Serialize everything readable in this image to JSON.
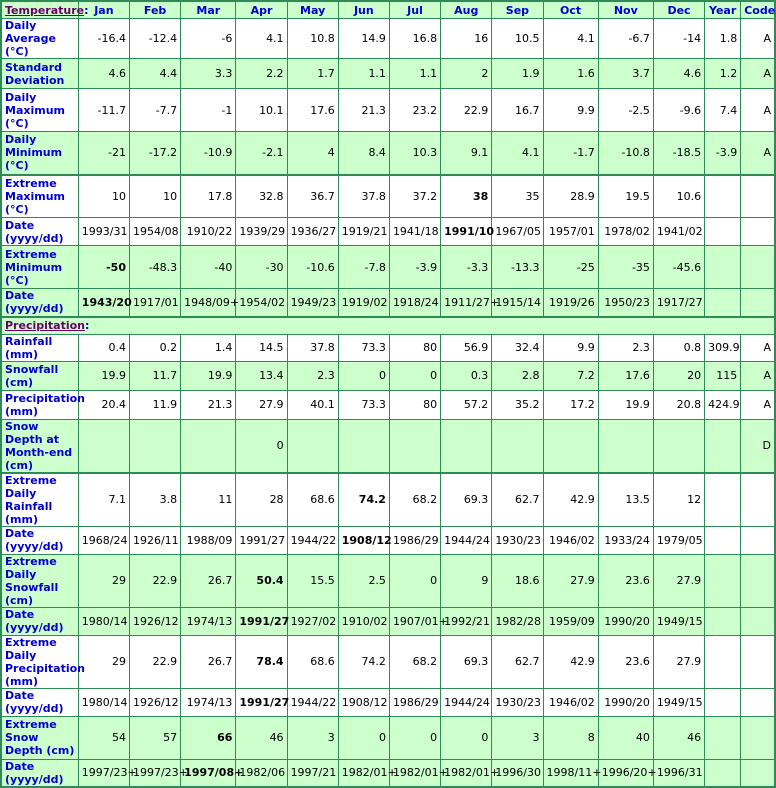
{
  "header": {
    "section_temperature": "Temperature",
    "section_precipitation": "Precipitation",
    "colon": ":",
    "months": [
      "Jan",
      "Feb",
      "Mar",
      "Apr",
      "May",
      "Jun",
      "Jul",
      "Aug",
      "Sep",
      "Oct",
      "Nov",
      "Dec"
    ],
    "year": "Year",
    "code": "Code"
  },
  "colors": {
    "green_row": "#ccffcc",
    "white_row": "#ffffff",
    "border": "#2e8b57",
    "label_text": "#0000cc",
    "section_link": "#660066"
  },
  "temperature": [
    {
      "label": "Daily Average (°C)",
      "style": "white",
      "values": [
        "-16.4",
        "-12.4",
        "-6",
        "4.1",
        "10.8",
        "14.9",
        "16.8",
        "16",
        "10.5",
        "4.1",
        "-6.7",
        "-14"
      ],
      "year": "1.8",
      "code": "A",
      "bold": []
    },
    {
      "label": "Standard Deviation",
      "style": "green",
      "values": [
        "4.6",
        "4.4",
        "3.3",
        "2.2",
        "1.7",
        "1.1",
        "1.1",
        "2",
        "1.9",
        "1.6",
        "3.7",
        "4.6"
      ],
      "year": "1.2",
      "code": "A",
      "bold": []
    },
    {
      "label": "Daily Maximum (°C)",
      "style": "white",
      "values": [
        "-11.7",
        "-7.7",
        "-1",
        "10.1",
        "17.6",
        "21.3",
        "23.2",
        "22.9",
        "16.7",
        "9.9",
        "-2.5",
        "-9.6"
      ],
      "year": "7.4",
      "code": "A",
      "bold": []
    },
    {
      "label": "Daily Minimum (°C)",
      "style": "green",
      "values": [
        "-21",
        "-17.2",
        "-10.9",
        "-2.1",
        "4",
        "8.4",
        "10.3",
        "9.1",
        "4.1",
        "-1.7",
        "-10.8",
        "-18.5"
      ],
      "year": "-3.9",
      "code": "A",
      "bold": []
    },
    {
      "label": "Extreme Maximum (°C)",
      "style": "white",
      "values": [
        "10",
        "10",
        "17.8",
        "32.8",
        "36.7",
        "37.8",
        "37.2",
        "38",
        "35",
        "28.9",
        "19.5",
        "10.6"
      ],
      "year": "",
      "code": "",
      "bold": [
        7
      ],
      "break": true
    },
    {
      "label": "Date (yyyy/dd)",
      "style": "white",
      "values": [
        "1993/31",
        "1954/08",
        "1910/22",
        "1939/29",
        "1936/27",
        "1919/21",
        "1941/18",
        "1991/10",
        "1967/05",
        "1957/01",
        "1978/02",
        "1941/02"
      ],
      "year": "",
      "code": "",
      "bold": [
        7
      ]
    },
    {
      "label": "Extreme Minimum (°C)",
      "style": "green",
      "values": [
        "-50",
        "-48.3",
        "-40",
        "-30",
        "-10.6",
        "-7.8",
        "-3.9",
        "-3.3",
        "-13.3",
        "-25",
        "-35",
        "-45.6"
      ],
      "year": "",
      "code": "",
      "bold": [
        0
      ]
    },
    {
      "label": "Date (yyyy/dd)",
      "style": "green",
      "values": [
        "1943/20",
        "1917/01",
        "1948/09+",
        "1954/02",
        "1949/23",
        "1919/02",
        "1918/24",
        "1911/27+",
        "1915/14",
        "1919/26",
        "1950/23",
        "1917/27"
      ],
      "year": "",
      "code": "",
      "bold": [
        0
      ]
    }
  ],
  "precipitation": [
    {
      "label": "Rainfall (mm)",
      "style": "white",
      "values": [
        "0.4",
        "0.2",
        "1.4",
        "14.5",
        "37.8",
        "73.3",
        "80",
        "56.9",
        "32.4",
        "9.9",
        "2.3",
        "0.8"
      ],
      "year": "309.9",
      "code": "A",
      "bold": []
    },
    {
      "label": "Snowfall (cm)",
      "style": "green",
      "values": [
        "19.9",
        "11.7",
        "19.9",
        "13.4",
        "2.3",
        "0",
        "0",
        "0.3",
        "2.8",
        "7.2",
        "17.6",
        "20"
      ],
      "year": "115",
      "code": "A",
      "bold": []
    },
    {
      "label": "Precipitation (mm)",
      "style": "white",
      "values": [
        "20.4",
        "11.9",
        "21.3",
        "27.9",
        "40.1",
        "73.3",
        "80",
        "57.2",
        "35.2",
        "17.2",
        "19.9",
        "20.8"
      ],
      "year": "424.9",
      "code": "A",
      "bold": []
    },
    {
      "label": "Snow Depth at Month-end (cm)",
      "style": "green",
      "values": [
        "",
        "",
        "",
        "0",
        "",
        "",
        "",
        "",
        "",
        "",
        "",
        ""
      ],
      "year": "",
      "code": "D",
      "bold": []
    },
    {
      "label": "Extreme Daily Rainfall (mm)",
      "style": "white",
      "values": [
        "7.1",
        "3.8",
        "11",
        "28",
        "68.6",
        "74.2",
        "68.2",
        "69.3",
        "62.7",
        "42.9",
        "13.5",
        "12"
      ],
      "year": "",
      "code": "",
      "bold": [
        5
      ],
      "break": true
    },
    {
      "label": "Date (yyyy/dd)",
      "style": "white",
      "values": [
        "1968/24",
        "1926/11",
        "1988/09",
        "1991/27",
        "1944/22",
        "1908/12",
        "1986/29",
        "1944/24",
        "1930/23",
        "1946/02",
        "1933/24",
        "1979/05"
      ],
      "year": "",
      "code": "",
      "bold": [
        5
      ]
    },
    {
      "label": "Extreme Daily Snowfall (cm)",
      "style": "green",
      "values": [
        "29",
        "22.9",
        "26.7",
        "50.4",
        "15.5",
        "2.5",
        "0",
        "9",
        "18.6",
        "27.9",
        "23.6",
        "27.9"
      ],
      "year": "",
      "code": "",
      "bold": [
        3
      ]
    },
    {
      "label": "Date (yyyy/dd)",
      "style": "green",
      "values": [
        "1980/14",
        "1926/12",
        "1974/13",
        "1991/27",
        "1927/02",
        "1910/02",
        "1907/01+",
        "1992/21",
        "1982/28",
        "1959/09",
        "1990/20",
        "1949/15"
      ],
      "year": "",
      "code": "",
      "bold": [
        3
      ]
    },
    {
      "label": "Extreme Daily Precipitation (mm)",
      "style": "white",
      "values": [
        "29",
        "22.9",
        "26.7",
        "78.4",
        "68.6",
        "74.2",
        "68.2",
        "69.3",
        "62.7",
        "42.9",
        "23.6",
        "27.9"
      ],
      "year": "",
      "code": "",
      "bold": [
        3
      ]
    },
    {
      "label": "Date (yyyy/dd)",
      "style": "white",
      "values": [
        "1980/14",
        "1926/12",
        "1974/13",
        "1991/27",
        "1944/22",
        "1908/12",
        "1986/29",
        "1944/24",
        "1930/23",
        "1946/02",
        "1990/20",
        "1949/15"
      ],
      "year": "",
      "code": "",
      "bold": [
        3
      ]
    },
    {
      "label": "Extreme Snow Depth (cm)",
      "style": "green",
      "values": [
        "54",
        "57",
        "66",
        "46",
        "3",
        "0",
        "0",
        "0",
        "3",
        "8",
        "40",
        "46"
      ],
      "year": "",
      "code": "",
      "bold": [
        2
      ]
    },
    {
      "label": "Date (yyyy/dd)",
      "style": "green",
      "values": [
        "1997/23+",
        "1997/23+",
        "1997/08+",
        "1982/06",
        "1997/21",
        "1982/01+",
        "1982/01+",
        "1982/01+",
        "1996/30",
        "1998/11+",
        "1996/20+",
        "1996/31"
      ],
      "year": "",
      "code": "",
      "bold": [
        2
      ]
    }
  ]
}
